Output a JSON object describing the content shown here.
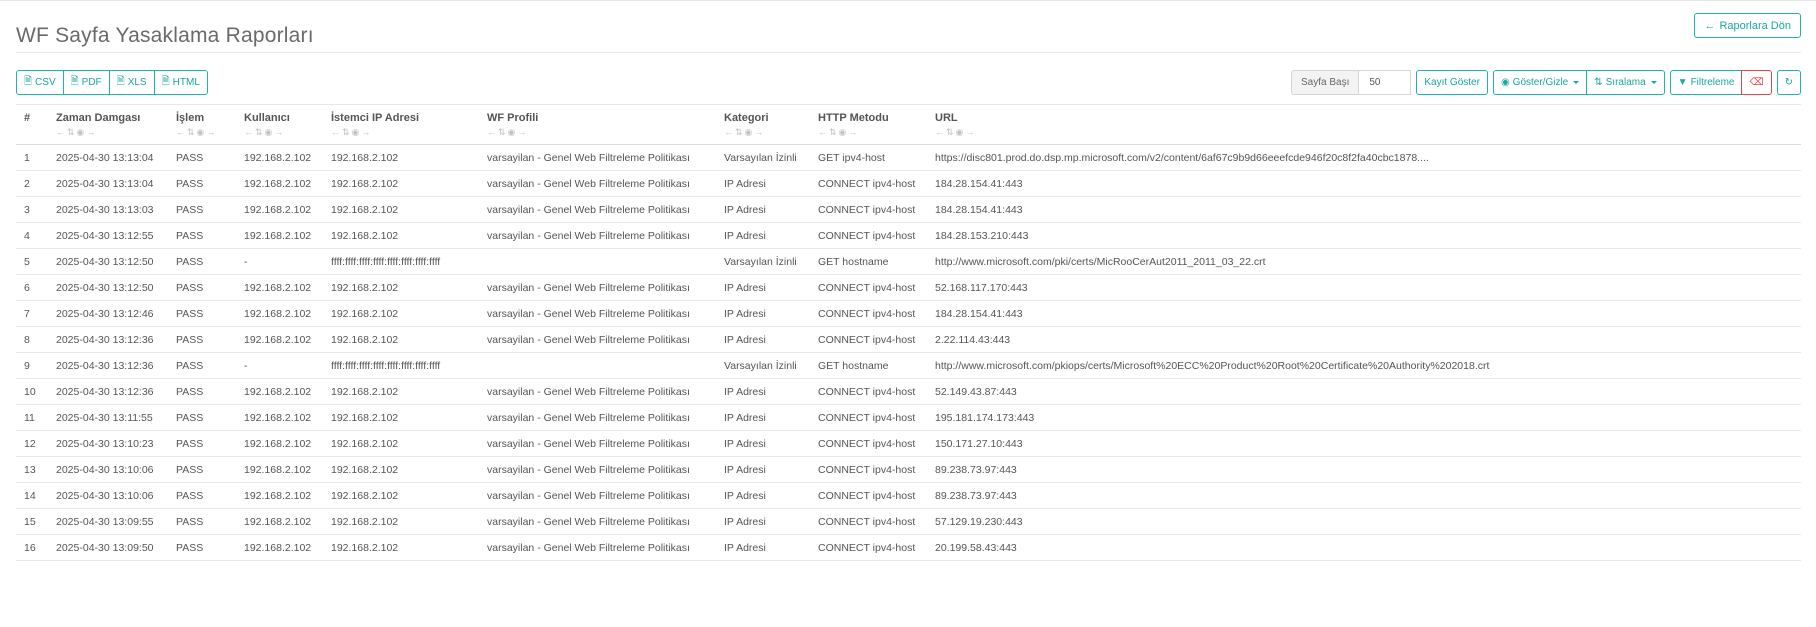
{
  "page": {
    "title": "WF Sayfa Yasaklama Raporları",
    "back_label": "Raporlara Dön"
  },
  "export": {
    "csv": "CSV",
    "pdf": "PDF",
    "xls": "XLS",
    "html": "HTML"
  },
  "controls": {
    "per_page_label": "Sayfa Başı",
    "per_page_value": "50",
    "show_records": "Kayıt Göster",
    "show_hide": "Göster/Gizle",
    "sort": "Sıralama",
    "filter": "Filtreleme"
  },
  "colors": {
    "accent": "#1fb5ac",
    "danger": "#e0474c"
  },
  "table": {
    "headers": [
      "#",
      "Zaman Damgası",
      "İşlem",
      "Kullanıcı",
      "İstemci IP Adresi",
      "WF Profili",
      "Kategori",
      "HTTP Metodu",
      "URL"
    ],
    "rows": [
      [
        "1",
        "2025-04-30 13:13:04",
        "PASS",
        "192.168.2.102",
        "192.168.2.102",
        "varsayilan - Genel Web Filtreleme Politikası",
        "Varsayılan İzinli",
        "GET ipv4-host",
        "https://disc801.prod.do.dsp.mp.microsoft.com/v2/content/6af67c9b9d66eeefcde946f20c8f2fa40cbc1878...."
      ],
      [
        "2",
        "2025-04-30 13:13:04",
        "PASS",
        "192.168.2.102",
        "192.168.2.102",
        "varsayilan - Genel Web Filtreleme Politikası",
        "IP Adresi",
        "CONNECT ipv4-host",
        "184.28.154.41:443"
      ],
      [
        "3",
        "2025-04-30 13:13:03",
        "PASS",
        "192.168.2.102",
        "192.168.2.102",
        "varsayilan - Genel Web Filtreleme Politikası",
        "IP Adresi",
        "CONNECT ipv4-host",
        "184.28.154.41:443"
      ],
      [
        "4",
        "2025-04-30 13:12:55",
        "PASS",
        "192.168.2.102",
        "192.168.2.102",
        "varsayilan - Genel Web Filtreleme Politikası",
        "IP Adresi",
        "CONNECT ipv4-host",
        "184.28.153.210:443"
      ],
      [
        "5",
        "2025-04-30 13:12:50",
        "PASS",
        "-",
        "ffff:ffff:ffff:ffff:ffff:ffff:ffff:ffff",
        "",
        "Varsayılan İzinli",
        "GET hostname",
        "http://www.microsoft.com/pki/certs/MicRooCerAut2011_2011_03_22.crt"
      ],
      [
        "6",
        "2025-04-30 13:12:50",
        "PASS",
        "192.168.2.102",
        "192.168.2.102",
        "varsayilan - Genel Web Filtreleme Politikası",
        "IP Adresi",
        "CONNECT ipv4-host",
        "52.168.117.170:443"
      ],
      [
        "7",
        "2025-04-30 13:12:46",
        "PASS",
        "192.168.2.102",
        "192.168.2.102",
        "varsayilan - Genel Web Filtreleme Politikası",
        "IP Adresi",
        "CONNECT ipv4-host",
        "184.28.154.41:443"
      ],
      [
        "8",
        "2025-04-30 13:12:36",
        "PASS",
        "192.168.2.102",
        "192.168.2.102",
        "varsayilan - Genel Web Filtreleme Politikası",
        "IP Adresi",
        "CONNECT ipv4-host",
        "2.22.114.43:443"
      ],
      [
        "9",
        "2025-04-30 13:12:36",
        "PASS",
        "-",
        "ffff:ffff:ffff:ffff:ffff:ffff:ffff:ffff",
        "",
        "Varsayılan İzinli",
        "GET hostname",
        "http://www.microsoft.com/pkiops/certs/Microsoft%20ECC%20Product%20Root%20Certificate%20Authority%202018.crt"
      ],
      [
        "10",
        "2025-04-30 13:12:36",
        "PASS",
        "192.168.2.102",
        "192.168.2.102",
        "varsayilan - Genel Web Filtreleme Politikası",
        "IP Adresi",
        "CONNECT ipv4-host",
        "52.149.43.87:443"
      ],
      [
        "11",
        "2025-04-30 13:11:55",
        "PASS",
        "192.168.2.102",
        "192.168.2.102",
        "varsayilan - Genel Web Filtreleme Politikası",
        "IP Adresi",
        "CONNECT ipv4-host",
        "195.181.174.173:443"
      ],
      [
        "12",
        "2025-04-30 13:10:23",
        "PASS",
        "192.168.2.102",
        "192.168.2.102",
        "varsayilan - Genel Web Filtreleme Politikası",
        "IP Adresi",
        "CONNECT ipv4-host",
        "150.171.27.10:443"
      ],
      [
        "13",
        "2025-04-30 13:10:06",
        "PASS",
        "192.168.2.102",
        "192.168.2.102",
        "varsayilan - Genel Web Filtreleme Politikası",
        "IP Adresi",
        "CONNECT ipv4-host",
        "89.238.73.97:443"
      ],
      [
        "14",
        "2025-04-30 13:10:06",
        "PASS",
        "192.168.2.102",
        "192.168.2.102",
        "varsayilan - Genel Web Filtreleme Politikası",
        "IP Adresi",
        "CONNECT ipv4-host",
        "89.238.73.97:443"
      ],
      [
        "15",
        "2025-04-30 13:09:55",
        "PASS",
        "192.168.2.102",
        "192.168.2.102",
        "varsayilan - Genel Web Filtreleme Politikası",
        "IP Adresi",
        "CONNECT ipv4-host",
        "57.129.19.230:443"
      ],
      [
        "16",
        "2025-04-30 13:09:50",
        "PASS",
        "192.168.2.102",
        "192.168.2.102",
        "varsayilan - Genel Web Filtreleme Politikası",
        "IP Adresi",
        "CONNECT ipv4-host",
        "20.199.58.43:443"
      ]
    ]
  }
}
